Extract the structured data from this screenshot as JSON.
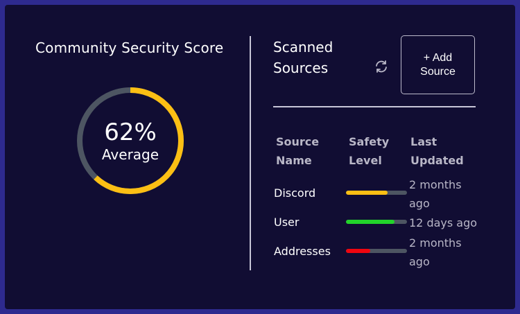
{
  "score": {
    "title": "Community Security Score",
    "percent_text": "62%",
    "percent": 62,
    "label": "Average",
    "colors": {
      "track": "#4d5562",
      "fill": "#fcbf14"
    }
  },
  "sources": {
    "title_line1": "Scanned",
    "title_line2": "Sources",
    "refresh_icon": "refresh-icon",
    "add_label_line1": "+ Add",
    "add_label_line2": "Source",
    "columns": {
      "name_line1": "Source",
      "name_line2": "Name",
      "safety_line1": "Safety",
      "safety_line2": "Level",
      "updated_line1": "Last",
      "updated_line2": "Updated"
    },
    "rows": [
      {
        "name": "Discord",
        "safety": 0.68,
        "color": "#fcbf14",
        "updated_line1": "2 months",
        "updated_line2": "ago"
      },
      {
        "name": "User",
        "safety": 0.8,
        "color": "#22d32a",
        "updated_line1": "12 days ago",
        "updated_line2": ""
      },
      {
        "name": "Addresses",
        "safety": 0.4,
        "color": "#f0050f",
        "updated_line1": "2 months",
        "updated_line2": "ago"
      }
    ]
  }
}
